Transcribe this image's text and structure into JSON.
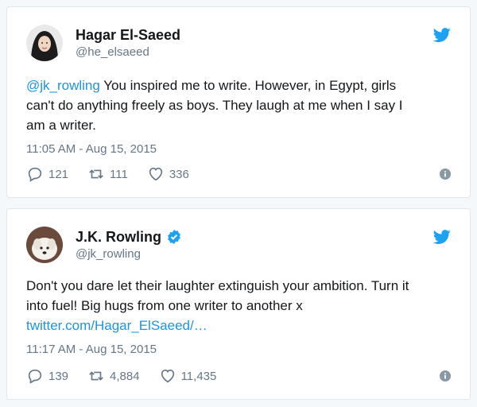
{
  "tweets": [
    {
      "name": "Hagar El-Saeed",
      "handle": "@he_elsaeed",
      "verified": false,
      "text_mention": "@jk_rowling",
      "text_line1_rest": " You inspired me to write. However, in Egypt, girls",
      "text_line2": "can't do anything freely as boys. They laugh at me when I say I",
      "text_line3": "am a writer.",
      "timestamp": "11:05 AM - Aug 15, 2015",
      "replies": "121",
      "retweets": "111",
      "likes": "336",
      "icons": [
        "avatar-woman-hijab",
        "twitter-bird-icon",
        "reply-icon",
        "retweet-icon",
        "heart-icon",
        "info-icon"
      ]
    },
    {
      "name": "J.K. Rowling",
      "handle": "@jk_rowling",
      "verified": true,
      "text_line1": "Don't you dare let their laughter extinguish your ambition. Turn it",
      "text_line2": "into fuel! Big hugs from one writer to another x",
      "text_link": "twitter.com/Hagar_ElSaeed/…",
      "timestamp": "11:17 AM - Aug 15, 2015",
      "replies": "139",
      "retweets": "4,884",
      "likes": "11,435",
      "icons": [
        "avatar-dog",
        "verified-badge-icon",
        "twitter-bird-icon",
        "reply-icon",
        "retweet-icon",
        "heart-icon",
        "info-icon"
      ]
    }
  ],
  "colors": {
    "link": "#1b95e0",
    "muted": "#657786",
    "text": "#14171a",
    "verified": "#1da1f2",
    "bird": "#1da1f2"
  }
}
